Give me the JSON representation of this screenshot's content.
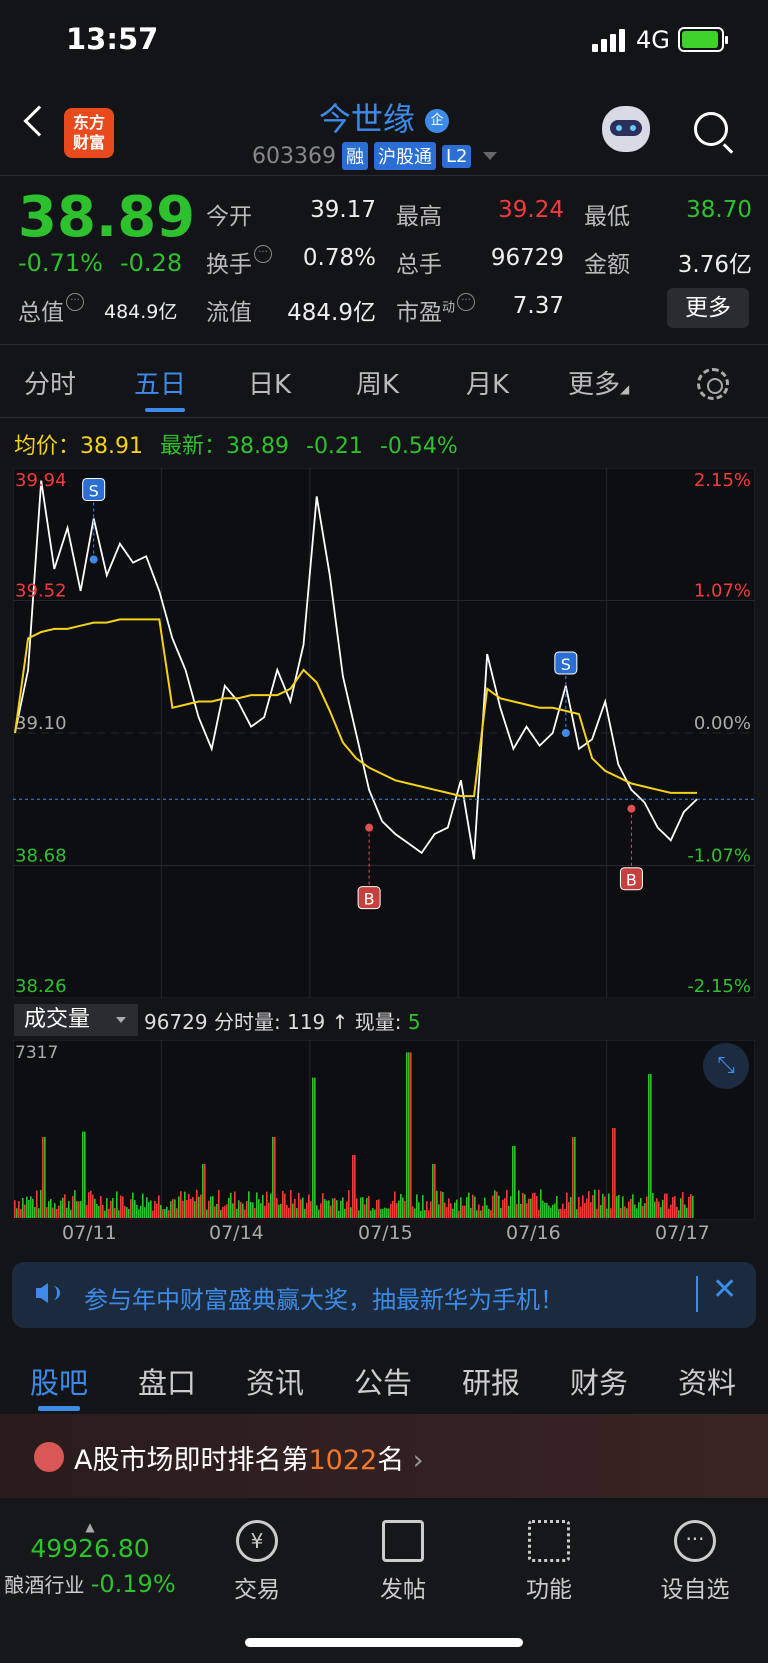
{
  "status": {
    "time": "13:57",
    "network": "4G"
  },
  "header": {
    "logo": "东方财富",
    "name": "今世缘",
    "badge": "企",
    "code": "603369",
    "tags": [
      "融",
      "沪股通",
      "L2"
    ]
  },
  "quote": {
    "price": "38.89",
    "pct": "-0.71%",
    "chg": "-0.28",
    "rows": [
      [
        {
          "k": "今开",
          "v": "39.17"
        },
        {
          "k": "最高",
          "v": "39.24",
          "c": "red"
        },
        {
          "k": "最低",
          "v": "38.70",
          "c": "green"
        }
      ],
      [
        {
          "k": "换手",
          "v": "0.78%"
        },
        {
          "k": "总手",
          "v": "96729"
        },
        {
          "k": "金额",
          "v": "3.76亿"
        }
      ],
      [
        {
          "k": "总值",
          "v": "484.9亿"
        },
        {
          "k": "流值",
          "v": "484.9亿"
        },
        {
          "k": "市盈",
          "sup": "动",
          "v": "7.37"
        }
      ]
    ],
    "more": "更多"
  },
  "tabs": [
    "分时",
    "五日",
    "日K",
    "周K",
    "月K",
    "更多"
  ],
  "avg": {
    "label": "均价：",
    "value": "38.91",
    "newlabel": "最新：",
    "newval": "38.89",
    "chg": "-0.21",
    "pct": "-0.54%"
  },
  "chart_data": {
    "type": "line",
    "title": "",
    "y_left": [
      "39.94",
      "39.52",
      "39.10",
      "38.68",
      "38.26"
    ],
    "y_right": [
      "2.15%",
      "1.07%",
      "0.00%",
      "-1.07%",
      "-2.15%"
    ],
    "ylim": [
      38.26,
      39.94
    ],
    "ref_price": 39.1,
    "current": 38.89,
    "x_dates": [
      "07/11",
      "07/14",
      "07/15",
      "07/16",
      "07/17"
    ],
    "series": [
      {
        "name": "",
        "values": [
          39.1,
          39.3,
          39.9,
          39.62,
          39.75,
          39.55,
          39.78,
          39.6,
          39.7,
          39.64,
          39.66,
          39.55,
          39.4,
          39.3,
          39.15,
          39.05,
          39.25,
          39.2,
          39.12,
          39.15,
          39.3,
          39.2,
          39.38,
          39.85,
          39.6,
          39.28,
          39.1,
          38.92,
          38.82,
          38.78,
          38.75,
          38.72,
          38.78,
          38.8,
          38.95,
          38.7,
          39.35,
          39.18,
          39.05,
          39.12,
          39.06,
          39.1,
          39.25,
          39.05,
          39.08,
          39.2,
          39.0,
          38.92,
          38.88,
          38.8,
          38.76,
          38.85,
          38.89
        ]
      },
      {
        "name": "",
        "values": [
          39.1,
          39.4,
          39.42,
          39.43,
          39.43,
          39.44,
          39.45,
          39.45,
          39.46,
          39.46,
          39.46,
          39.46,
          39.18,
          39.19,
          39.2,
          39.2,
          39.21,
          39.21,
          39.22,
          39.22,
          39.22,
          39.24,
          39.3,
          39.26,
          39.17,
          39.07,
          39.02,
          38.99,
          38.97,
          38.95,
          38.94,
          38.93,
          38.92,
          38.91,
          38.9,
          38.9,
          39.24,
          39.21,
          39.2,
          39.19,
          39.18,
          39.18,
          39.17,
          39.16,
          39.02,
          38.98,
          38.96,
          38.94,
          38.93,
          38.92,
          38.91,
          38.91,
          38.91
        ]
      }
    ],
    "markers": [
      {
        "type": "S",
        "x_index": 6,
        "price": 39.65
      },
      {
        "type": "B",
        "x_index": 27,
        "price": 38.8
      },
      {
        "type": "S",
        "x_index": 42,
        "price": 39.1
      },
      {
        "type": "B",
        "x_index": 47,
        "price": 38.86
      }
    ]
  },
  "volume": {
    "selector": "成交量",
    "total": "96729",
    "label": "分时量:",
    "value": "119",
    "arrow": "↑",
    "nowlabel": "现量:",
    "now": "5",
    "max": "7317"
  },
  "banner": {
    "text": "参与年中财富盛典赢大奖，抽最新华为手机！"
  },
  "bottomtabs": [
    "股吧",
    "盘口",
    "资讯",
    "公告",
    "研报",
    "财务",
    "资料"
  ],
  "rank": {
    "pre": "A股市场即时排名第",
    "num": "1022",
    "post": "名"
  },
  "nav": {
    "index_value": "49926.80",
    "industry": "酿酒行业",
    "industry_pct": "-0.19%",
    "items": [
      "交易",
      "发帖",
      "功能",
      "设自选"
    ]
  }
}
